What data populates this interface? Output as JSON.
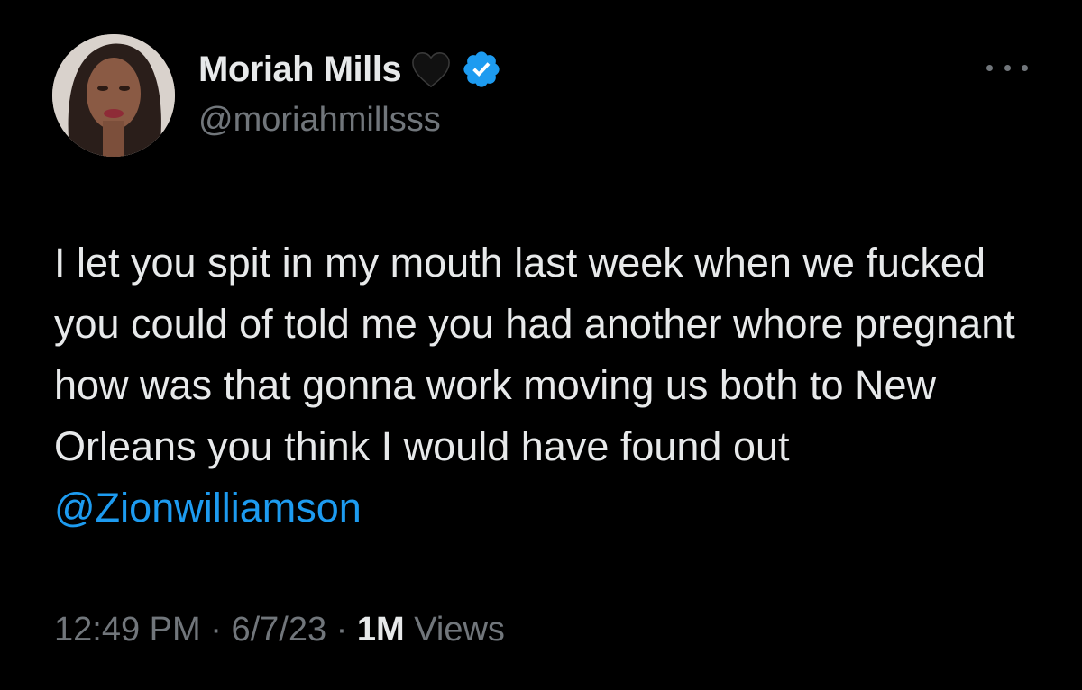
{
  "author": {
    "display_name": "Moriah Mills",
    "handle": "@moriahmillsss",
    "badges": [
      "black-heart-icon",
      "verified-badge-icon"
    ]
  },
  "tweet": {
    "text": "I let you spit in my mouth last week when we fucked you could of told me you had another whore pregnant how was that gonna work moving us both to New Orleans you think I would have found out ",
    "mention": "@Zionwilliamson"
  },
  "meta": {
    "time": "12:49 PM",
    "separator": "·",
    "date": "6/7/23",
    "views_count": "1M",
    "views_label": "Views"
  },
  "colors": {
    "background": "#000000",
    "primary_text": "#e7e9ea",
    "secondary_text": "#71767b",
    "link": "#1d9bf0",
    "verified": "#1d9bf0"
  }
}
